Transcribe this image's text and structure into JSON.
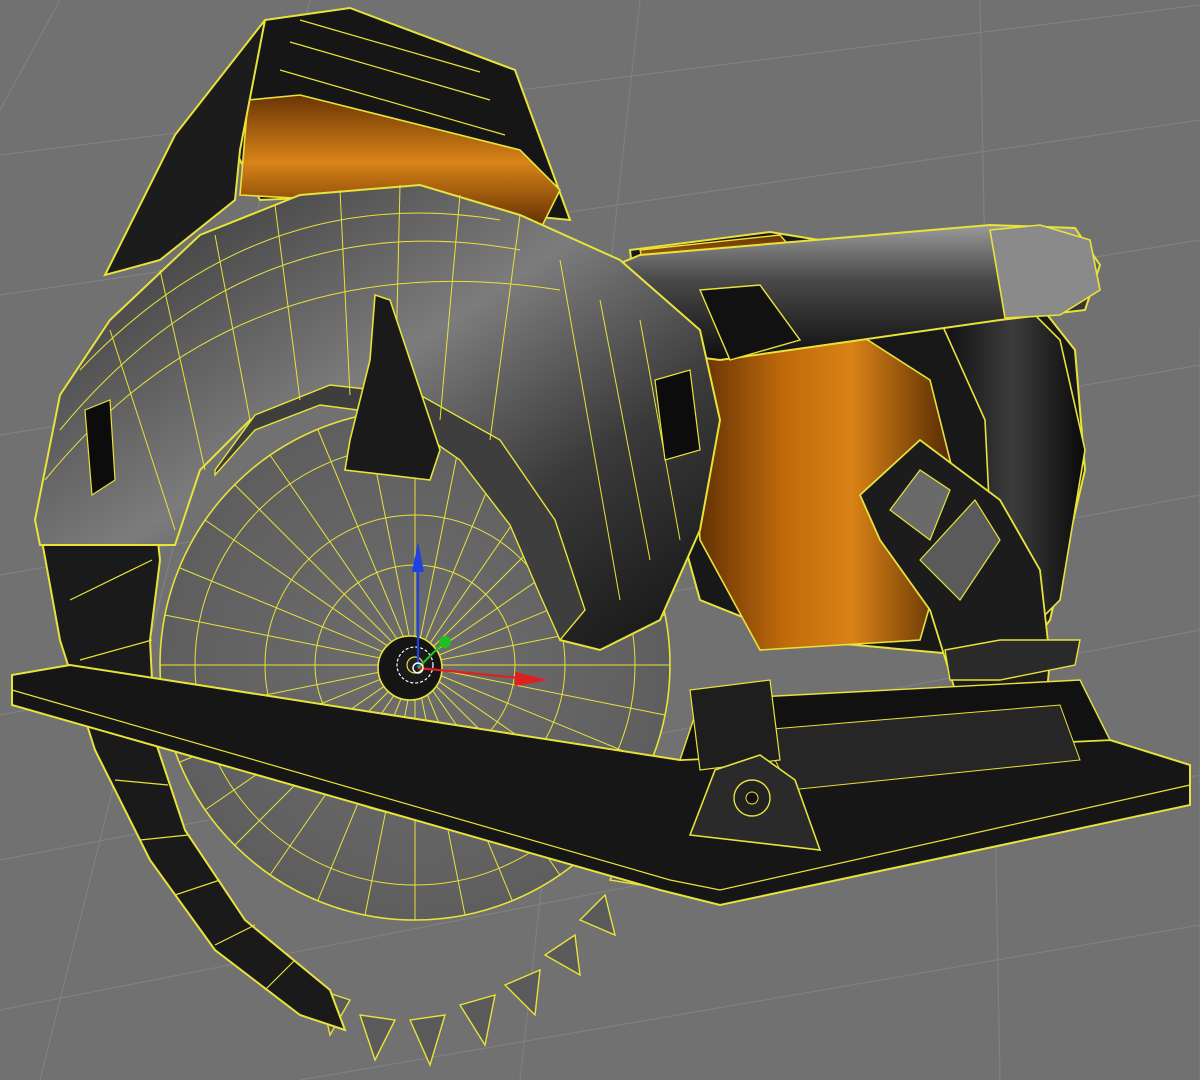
{
  "viewport": {
    "kind": "3d-viewport",
    "display_mode": "solid-with-wireframe-overlay",
    "selection": "circular-saw-model",
    "selected_edge_color": "#e8e23a",
    "background_color": "#717171",
    "grid_color": "#828282",
    "object_colors": {
      "casing": "#1a1a1a",
      "casing_highlight": "#8c8c8c",
      "motor_copper": "#b8620a",
      "motor_copper_highlight": "#e08a1e"
    },
    "transform_gizmo": {
      "x_axis_color": "#e02020",
      "y_axis_color": "#20c020",
      "z_axis_color": "#2040e0"
    }
  }
}
